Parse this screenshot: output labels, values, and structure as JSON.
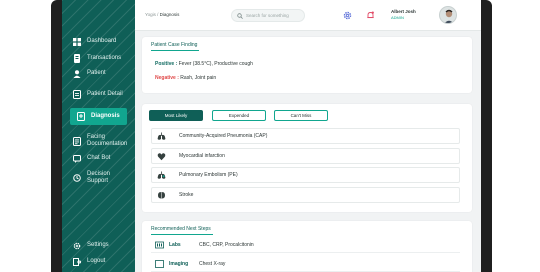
{
  "breadcrumb": {
    "parent": "Yogis /",
    "current": "Diagnosis"
  },
  "search": {
    "placeholder": "Search for something"
  },
  "user": {
    "name": "Albert Josh",
    "role": "ADMIN"
  },
  "sidebar": {
    "items": [
      {
        "label": "Dashboard",
        "icon": "dashboard-icon"
      },
      {
        "label": "Transactions",
        "icon": "transactions-icon"
      },
      {
        "label": "Patient",
        "icon": "patient-icon"
      },
      {
        "label": "Patient Detail",
        "icon": "patient-detail-icon"
      },
      {
        "label": "Diagnosis",
        "icon": "diagnosis-icon"
      },
      {
        "label": "Facing Documentation",
        "icon": "documentation-icon"
      },
      {
        "label": "Chat Bot",
        "icon": "chat-icon"
      },
      {
        "label": "Decision Support",
        "icon": "decision-support-icon"
      },
      {
        "label": "Settings",
        "icon": "settings-icon"
      },
      {
        "label": "Logout",
        "icon": "logout-icon"
      }
    ]
  },
  "findings": {
    "title": "Patient Case Finding",
    "positive_label": "Positive :",
    "positive_text": "Fever (38.5°C), Productive cough",
    "negative_label": "Negative :",
    "negative_text": "Rash, Joint pain"
  },
  "diagnosis_tabs": [
    "Most Likely",
    "Expended",
    "Can't Miss"
  ],
  "diagnoses": [
    {
      "name": "Community-Acquired Pneumonia (CAP)",
      "icon": "lungs-icon"
    },
    {
      "name": "Myocardial infarction",
      "icon": "heart-icon"
    },
    {
      "name": "Pulmonary Embolism (PE)",
      "icon": "lungs-clot-icon"
    },
    {
      "name": "Stroke",
      "icon": "brain-icon"
    }
  ],
  "next_steps": {
    "title": "Recommended Next Steps",
    "items": [
      {
        "label": "Labs",
        "value": "CBC, CRP, Procalcitonin",
        "icon": "labs-icon"
      },
      {
        "label": "Imaging",
        "value": "Chest X-ray",
        "icon": "imaging-icon"
      }
    ]
  },
  "colors": {
    "sidebar": "#0f5f57",
    "accent": "#11a68f",
    "negative": "#e04a4a"
  }
}
